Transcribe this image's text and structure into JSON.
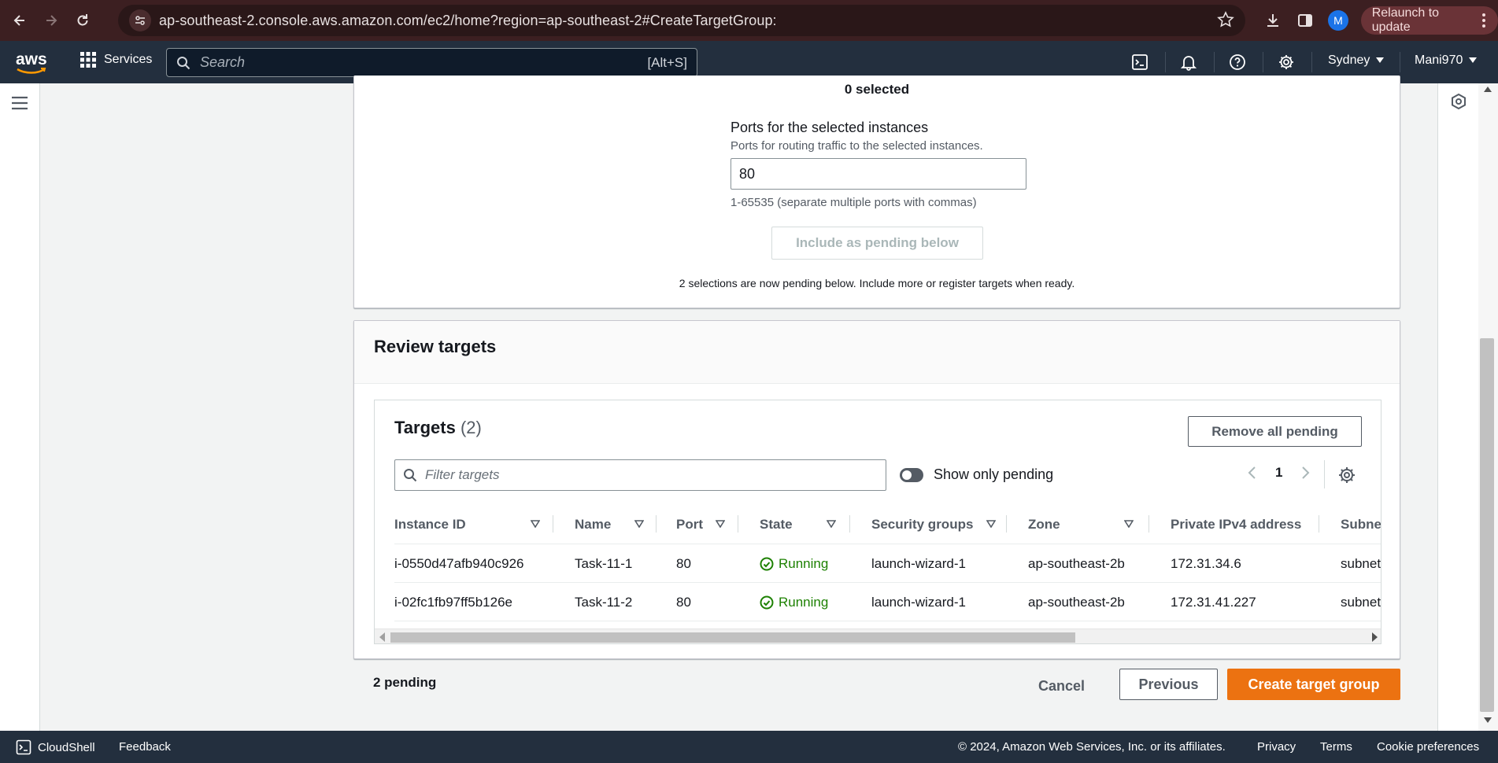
{
  "browser": {
    "url": "ap-southeast-2.console.aws.amazon.com/ec2/home?region=ap-southeast-2#CreateTargetGroup:",
    "profile_initial": "M",
    "relaunch_label": "Relaunch to update"
  },
  "aws_nav": {
    "logo": "aws",
    "services_label": "Services",
    "search_placeholder": "Search",
    "search_shortcut": "[Alt+S]",
    "region": "Sydney",
    "account": "Mani970"
  },
  "register": {
    "selected_count": "0 selected",
    "ports_label": "Ports for the selected instances",
    "ports_description": "Ports for routing traffic to the selected instances.",
    "ports_value": "80",
    "ports_hint": "1-65535 (separate multiple ports with commas)",
    "include_button": "Include as pending below",
    "pending_message": "2 selections are now pending below. Include more or register targets when ready."
  },
  "review": {
    "title": "Review targets",
    "targets_title": "Targets",
    "targets_count": "(2)",
    "remove_all_button": "Remove all pending",
    "filter_placeholder": "Filter targets",
    "show_only_pending_label": "Show only pending",
    "show_only_pending_on": false,
    "current_page": "1",
    "columns": [
      "Instance ID",
      "Name",
      "Port",
      "State",
      "Security groups",
      "Zone",
      "Private IPv4 address",
      "Subnet"
    ],
    "rows": [
      {
        "instance_id": "i-0550d47afb940c926",
        "name": "Task-11-1",
        "port": "80",
        "state": "Running",
        "security_groups": "launch-wizard-1",
        "zone": "ap-southeast-2b",
        "ipv4": "172.31.34.6",
        "subnet": "subnet"
      },
      {
        "instance_id": "i-02fc1fb97ff5b126e",
        "name": "Task-11-2",
        "port": "80",
        "state": "Running",
        "security_groups": "launch-wizard-1",
        "zone": "ap-southeast-2b",
        "ipv4": "172.31.41.227",
        "subnet": "subnet"
      }
    ]
  },
  "actions": {
    "pending_count": "2 pending",
    "cancel": "Cancel",
    "previous": "Previous",
    "create": "Create target group"
  },
  "footer": {
    "cloudshell": "CloudShell",
    "feedback": "Feedback",
    "copyright": "© 2024, Amazon Web Services, Inc. or its affiliates.",
    "privacy": "Privacy",
    "terms": "Terms",
    "cookie": "Cookie preferences"
  },
  "colors": {
    "primary_button": "#ec7211",
    "running": "#1d8102",
    "aws_nav": "#232f3e",
    "browser_chrome": "#3c1f21"
  }
}
